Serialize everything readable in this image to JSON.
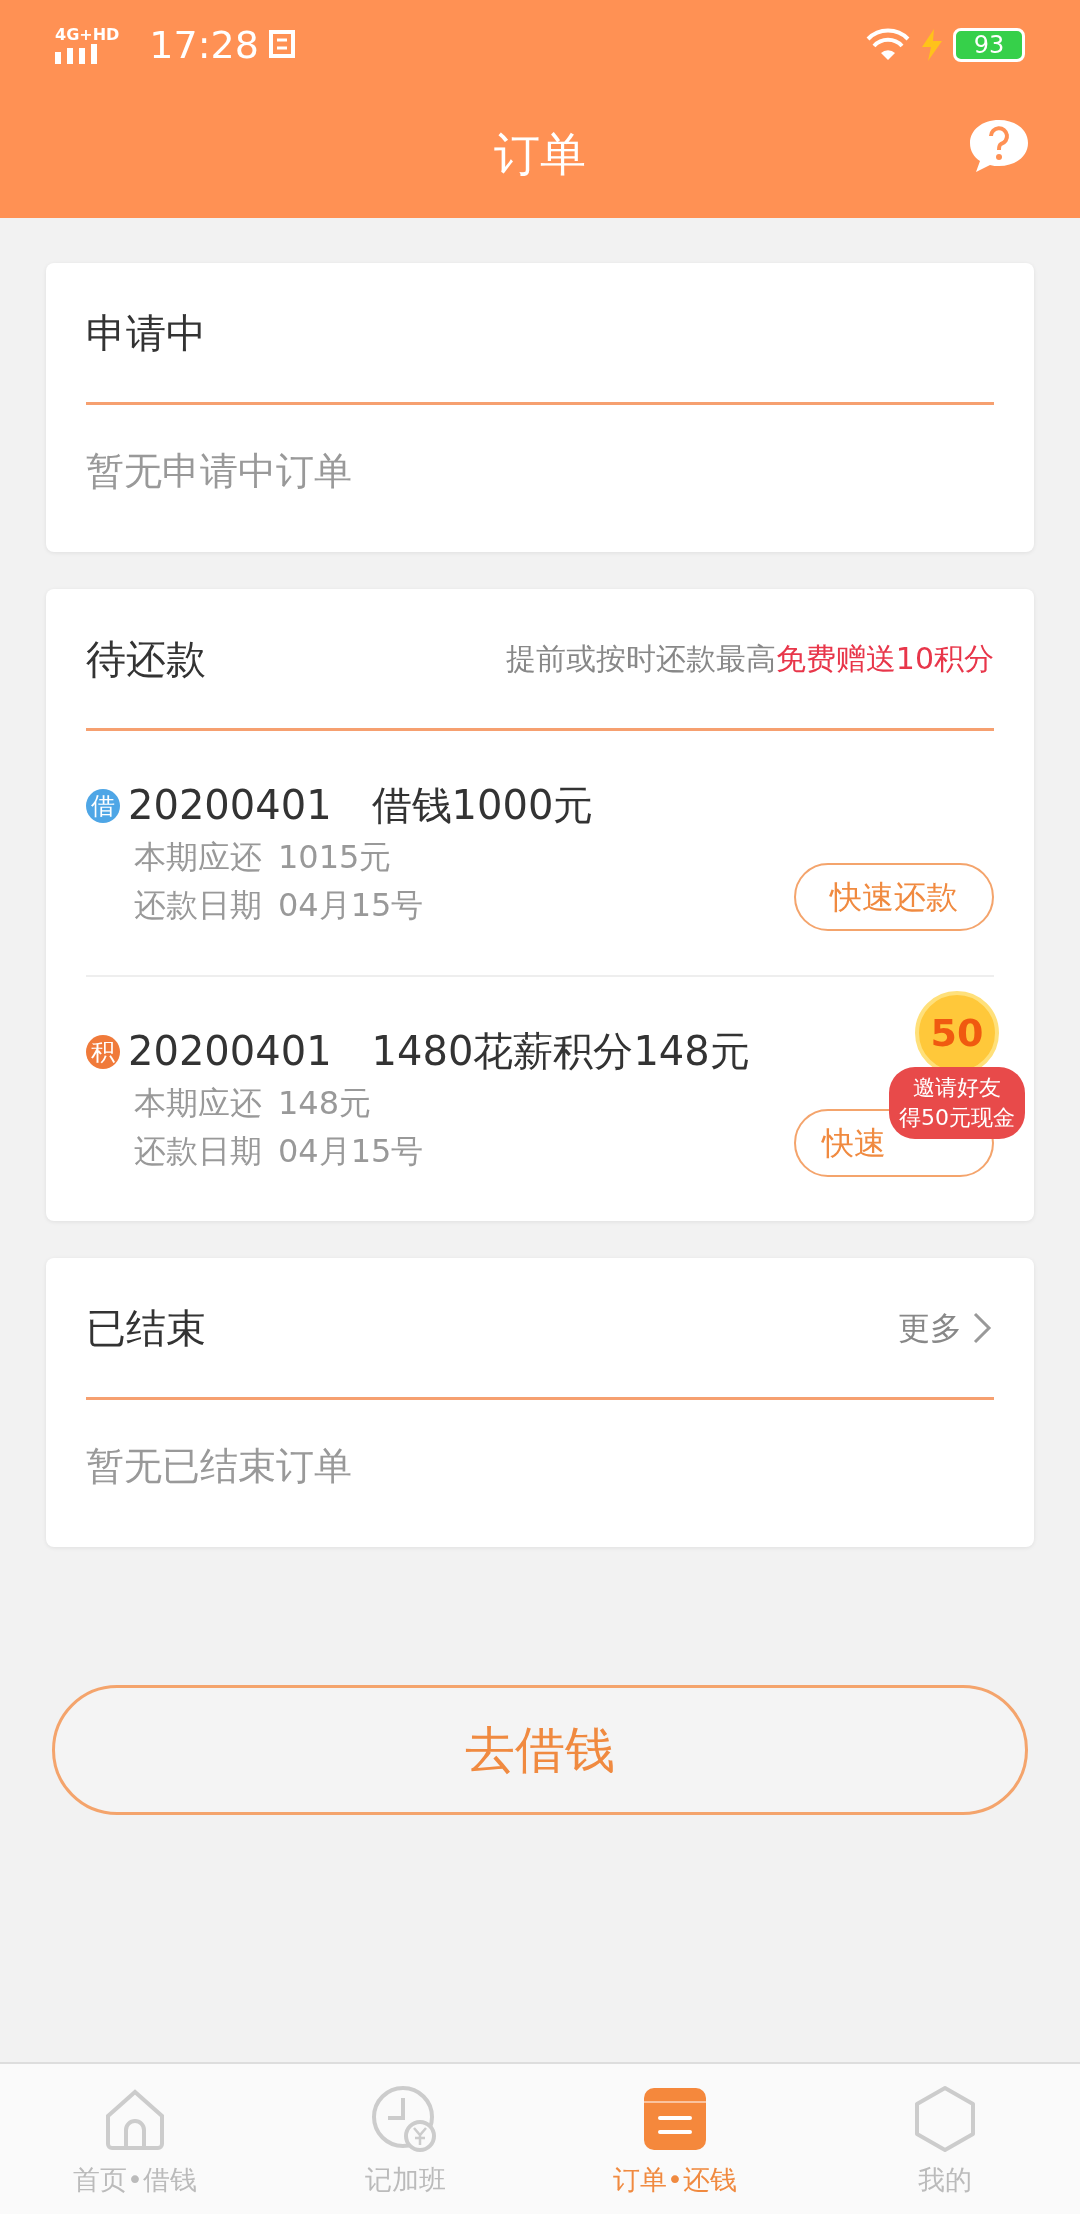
{
  "status_bar": {
    "network": "4G+HD",
    "time": "17:28",
    "battery": "93",
    "charging": true
  },
  "header": {
    "title": "订单"
  },
  "sections": [
    {
      "kind": "empty",
      "title": "申请中",
      "empty_text": "暂无申请中订单"
    },
    {
      "kind": "orders",
      "title": "待还款",
      "note": "提前或按时还款最高**免费赠送10积分**",
      "orders": [
        {
          "tag": "借",
          "color": "#4ea6e6",
          "number": "20200401",
          "name": "借钱1000元",
          "amount_label": "本期应还",
          "amount": "1015元",
          "date_label": "还款日期",
          "date": "04月15号",
          "button": "快速还款"
        },
        {
          "tag": "积",
          "color": "#f07a3a",
          "number": "20200401",
          "name": "1480花薪积分148元",
          "amount_label": "本期应还",
          "amount": "148元",
          "date_label": "还款日期",
          "date": "04月15号",
          "button": "快速"
        }
      ]
    },
    {
      "kind": "empty",
      "title": "已结束",
      "more": "更多",
      "empty_text": "暂无已结束订单"
    }
  ],
  "promo": {
    "coin": "50",
    "line1": "邀请好友",
    "line2": "得50元现金"
  },
  "main_button": "去借钱",
  "tabs": [
    {
      "label": "首页•借钱",
      "selected": false
    },
    {
      "label": "记加班",
      "selected": false
    },
    {
      "label": "订单•还钱",
      "selected": true
    },
    {
      "label": "我的",
      "selected": false
    }
  ]
}
